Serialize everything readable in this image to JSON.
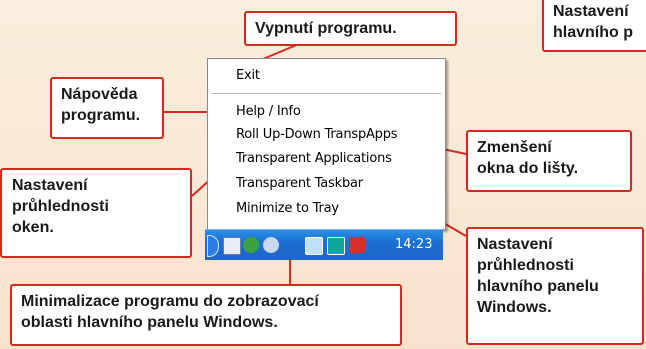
{
  "menu": {
    "items": [
      {
        "label": "Exit"
      },
      {
        "label": "Help / Info"
      },
      {
        "label": "Roll Up-Down TranspApps"
      },
      {
        "label": "Transparent Applications"
      },
      {
        "label": "Transparent Taskbar"
      },
      {
        "label": "Minimize to Tray"
      }
    ]
  },
  "taskbar": {
    "clock": "14:23"
  },
  "callouts": {
    "exit": [
      "Vypnutí programu."
    ],
    "help": [
      "Nápověda",
      "programu."
    ],
    "transparency": [
      "Nastavení",
      "průhlednosti",
      "oken."
    ],
    "rollup": [
      "Zmenšení",
      "okna do lišty."
    ],
    "taskbar": [
      "Nastavení",
      "průhlednosti",
      "hlavního panelu",
      "Windows."
    ],
    "tray": [
      "Minimalizace programu do zobrazovací",
      "oblasti hlavního panelu Windows."
    ],
    "corner": [
      "Nastavení",
      "hlavního p"
    ]
  },
  "colors": {
    "accent": "#d42a20",
    "taskbar": "#1f66c7"
  }
}
